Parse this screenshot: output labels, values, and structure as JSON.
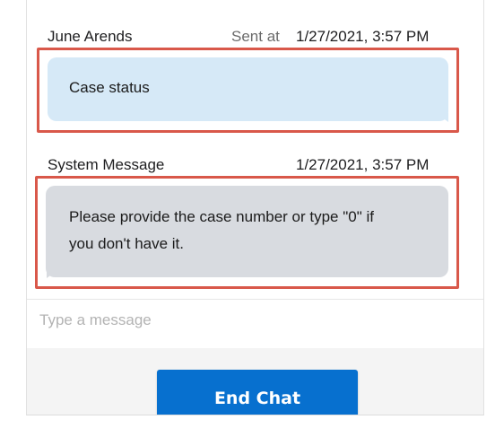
{
  "messages": [
    {
      "sender": "June Arends",
      "sent_prefix": "Sent at",
      "timestamp": "1/27/2021, 3:57 PM",
      "text": "Case status"
    },
    {
      "sender": "System Message",
      "timestamp": "1/27/2021, 3:57 PM",
      "text_line1": "Please provide the case number or type \"0\" if",
      "text_line2": "you don't have it."
    }
  ],
  "composer": {
    "placeholder": "Type a message"
  },
  "footer": {
    "end_chat_label": "End Chat"
  },
  "colors": {
    "highlight_outline": "#d9584a",
    "outgoing_bubble": "#d6e9f7",
    "incoming_bubble": "#d8dbe0",
    "primary_button": "#0770cf"
  }
}
